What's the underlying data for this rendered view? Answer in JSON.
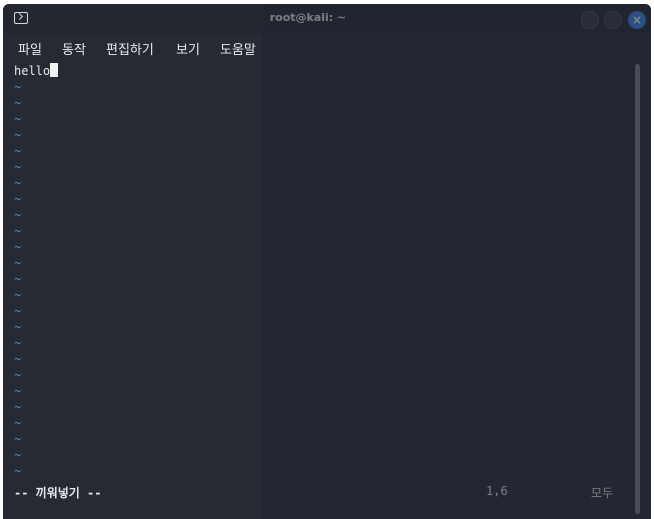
{
  "window": {
    "title": "root@kali: ~",
    "close_glyph": "×"
  },
  "menu": {
    "items": [
      "파일",
      "동작",
      "편집하기",
      "보기",
      "도움말"
    ]
  },
  "editor": {
    "first_line": "hello",
    "empty_line_marker": "~",
    "empty_line_count": 25,
    "mode": "-- 끼워넣기 --",
    "cursor_position": "1,6",
    "scroll_scope": "모두"
  },
  "colors": {
    "background": "#262a33",
    "tilde": "#3d8fd6",
    "close_button": "#3a83e6",
    "text": "#e6e8ec"
  },
  "icons": {
    "app": "terminal-icon",
    "minimize": "minimize-icon",
    "maximize": "maximize-icon",
    "close": "close-icon"
  }
}
